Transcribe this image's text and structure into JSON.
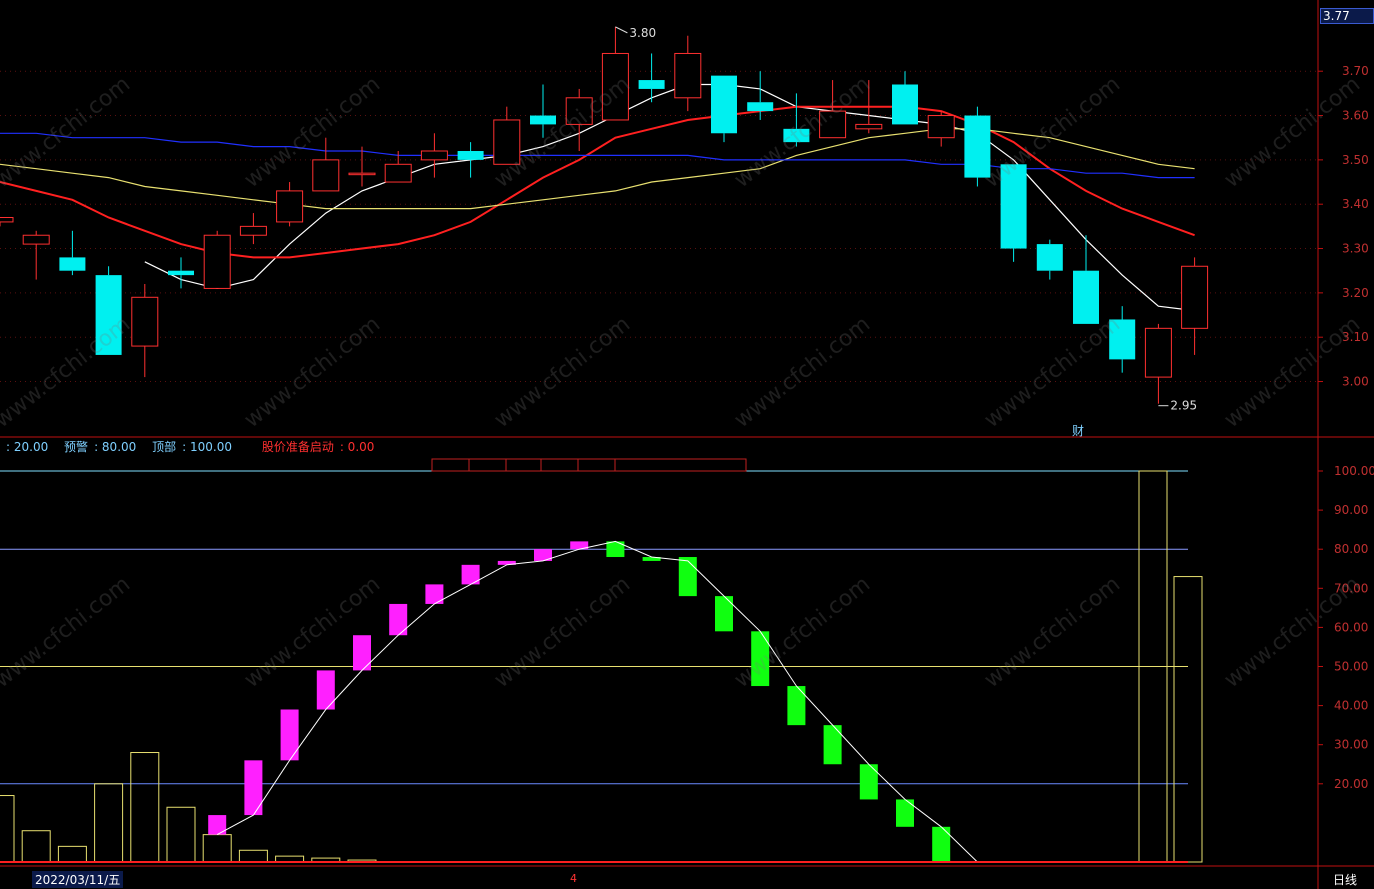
{
  "chart_data": [
    {
      "type": "candlestick",
      "title": "",
      "ylim": [
        2.92,
        3.82
      ],
      "y_ticks": [
        "3.70",
        "3.60",
        "3.50",
        "3.40",
        "3.30",
        "3.20",
        "3.10",
        "3.00"
      ],
      "high_label": "3.80",
      "low_label": "2.95",
      "current_price": "3.77",
      "candles": [
        {
          "o": 3.36,
          "c": 3.37,
          "h": 3.37,
          "l": 3.35
        },
        {
          "o": 3.31,
          "c": 3.33,
          "h": 3.34,
          "l": 3.23
        },
        {
          "o": 3.28,
          "c": 3.25,
          "h": 3.34,
          "l": 3.24
        },
        {
          "o": 3.24,
          "c": 3.06,
          "h": 3.26,
          "l": 3.06
        },
        {
          "o": 3.08,
          "c": 3.19,
          "h": 3.22,
          "l": 3.01
        },
        {
          "o": 3.25,
          "c": 3.24,
          "h": 3.28,
          "l": 3.21
        },
        {
          "o": 3.21,
          "c": 3.33,
          "h": 3.34,
          "l": 3.21
        },
        {
          "o": 3.33,
          "c": 3.35,
          "h": 3.38,
          "l": 3.31
        },
        {
          "o": 3.36,
          "c": 3.43,
          "h": 3.45,
          "l": 3.35
        },
        {
          "o": 3.43,
          "c": 3.5,
          "h": 3.55,
          "l": 3.43
        },
        {
          "o": 3.47,
          "c": 3.47,
          "h": 3.53,
          "l": 3.44
        },
        {
          "o": 3.45,
          "c": 3.49,
          "h": 3.52,
          "l": 3.45
        },
        {
          "o": 3.5,
          "c": 3.52,
          "h": 3.56,
          "l": 3.46
        },
        {
          "o": 3.52,
          "c": 3.5,
          "h": 3.54,
          "l": 3.46
        },
        {
          "o": 3.49,
          "c": 3.59,
          "h": 3.62,
          "l": 3.49
        },
        {
          "o": 3.6,
          "c": 3.58,
          "h": 3.67,
          "l": 3.55
        },
        {
          "o": 3.58,
          "c": 3.64,
          "h": 3.66,
          "l": 3.52
        },
        {
          "o": 3.59,
          "c": 3.74,
          "h": 3.8,
          "l": 3.59
        },
        {
          "o": 3.68,
          "c": 3.66,
          "h": 3.74,
          "l": 3.63
        },
        {
          "o": 3.64,
          "c": 3.74,
          "h": 3.78,
          "l": 3.61
        },
        {
          "o": 3.69,
          "c": 3.56,
          "h": 3.69,
          "l": 3.54
        },
        {
          "o": 3.63,
          "c": 3.61,
          "h": 3.7,
          "l": 3.59
        },
        {
          "o": 3.57,
          "c": 3.54,
          "h": 3.65,
          "l": 3.53
        },
        {
          "o": 3.55,
          "c": 3.61,
          "h": 3.68,
          "l": 3.55
        },
        {
          "o": 3.57,
          "c": 3.58,
          "h": 3.68,
          "l": 3.56
        },
        {
          "o": 3.67,
          "c": 3.58,
          "h": 3.7,
          "l": 3.58
        },
        {
          "o": 3.55,
          "c": 3.6,
          "h": 3.61,
          "l": 3.53
        },
        {
          "o": 3.6,
          "c": 3.46,
          "h": 3.62,
          "l": 3.44
        },
        {
          "o": 3.49,
          "c": 3.3,
          "h": 3.49,
          "l": 3.27
        },
        {
          "o": 3.31,
          "c": 3.25,
          "h": 3.32,
          "l": 3.23
        },
        {
          "o": 3.25,
          "c": 3.13,
          "h": 3.33,
          "l": 3.13
        },
        {
          "o": 3.14,
          "c": 3.05,
          "h": 3.17,
          "l": 3.02
        },
        {
          "o": 3.01,
          "c": 3.12,
          "h": 3.13,
          "l": 2.95
        },
        {
          "o": 3.12,
          "c": 3.26,
          "h": 3.28,
          "l": 3.06
        }
      ],
      "ma_lines": [
        {
          "color": "#ffffff",
          "values": [
            null,
            null,
            null,
            null,
            3.27,
            3.23,
            3.21,
            3.23,
            3.31,
            3.38,
            3.43,
            3.46,
            3.49,
            3.5,
            3.51,
            3.53,
            3.56,
            3.6,
            3.64,
            3.67,
            3.67,
            3.66,
            3.62,
            3.61,
            3.6,
            3.59,
            3.58,
            3.56,
            3.5,
            3.41,
            3.32,
            3.24,
            3.17,
            3.16
          ]
        },
        {
          "color": "#ff2020",
          "values": [
            3.45,
            3.43,
            3.41,
            3.37,
            3.34,
            3.31,
            3.29,
            3.28,
            3.28,
            3.29,
            3.3,
            3.31,
            3.33,
            3.36,
            3.41,
            3.46,
            3.5,
            3.55,
            3.57,
            3.59,
            3.6,
            3.61,
            3.62,
            3.62,
            3.62,
            3.62,
            3.61,
            3.58,
            3.54,
            3.48,
            3.43,
            3.39,
            3.36,
            3.33
          ]
        },
        {
          "color": "#e8e070",
          "values": [
            3.49,
            3.48,
            3.47,
            3.46,
            3.44,
            3.43,
            3.42,
            3.41,
            3.4,
            3.39,
            3.39,
            3.39,
            3.39,
            3.39,
            3.4,
            3.41,
            3.42,
            3.43,
            3.45,
            3.46,
            3.47,
            3.48,
            3.51,
            3.53,
            3.55,
            3.56,
            3.57,
            3.57,
            3.56,
            3.55,
            3.53,
            3.51,
            3.49,
            3.48
          ]
        },
        {
          "color": "#2030ff",
          "values": [
            3.56,
            3.56,
            3.55,
            3.55,
            3.55,
            3.54,
            3.54,
            3.53,
            3.53,
            3.52,
            3.52,
            3.51,
            3.51,
            3.51,
            3.51,
            3.51,
            3.51,
            3.51,
            3.51,
            3.51,
            3.5,
            3.5,
            3.5,
            3.5,
            3.5,
            3.5,
            3.49,
            3.49,
            3.48,
            3.48,
            3.47,
            3.47,
            3.46,
            3.46
          ]
        }
      ]
    },
    {
      "type": "oscillator",
      "ylim": [
        0,
        100
      ],
      "y_ticks": [
        "100.00",
        "90.00",
        "80.00",
        "70.00",
        "60.00",
        "50.00",
        "40.00",
        "30.00",
        "20.00"
      ],
      "legend": [
        {
          "label": "",
          "value": ": 20.00",
          "color": "#7fd0ff"
        },
        {
          "label": "预警",
          "value": ": 80.00",
          "color": "#7fd0ff"
        },
        {
          "label": "顶部",
          "value": ": 100.00",
          "color": "#7fd0ff"
        },
        {
          "label": "股价准备启动",
          "value": ": 0.00",
          "color": "#ff3030"
        }
      ],
      "boxes": [
        {
          "from": null,
          "to": null,
          "dir": "none"
        },
        {
          "from": null,
          "to": null,
          "dir": "none"
        },
        {
          "from": null,
          "to": null,
          "dir": "none"
        },
        {
          "from": null,
          "to": null,
          "dir": "none"
        },
        {
          "from": null,
          "to": null,
          "dir": "none"
        },
        {
          "from": null,
          "to": null,
          "dir": "none"
        },
        {
          "from": 7,
          "to": 12,
          "dir": "up"
        },
        {
          "from": 12,
          "to": 26,
          "dir": "up"
        },
        {
          "from": 26,
          "to": 39,
          "dir": "up"
        },
        {
          "from": 39,
          "to": 49,
          "dir": "up"
        },
        {
          "from": 49,
          "to": 58,
          "dir": "up"
        },
        {
          "from": 58,
          "to": 66,
          "dir": "up"
        },
        {
          "from": 66,
          "to": 71,
          "dir": "up"
        },
        {
          "from": 71,
          "to": 76,
          "dir": "up"
        },
        {
          "from": 76,
          "to": 77,
          "dir": "up"
        },
        {
          "from": 77,
          "to": 80,
          "dir": "up"
        },
        {
          "from": 80,
          "to": 82,
          "dir": "up"
        },
        {
          "from": 82,
          "to": 78,
          "dir": "down"
        },
        {
          "from": 78,
          "to": 77,
          "dir": "down"
        },
        {
          "from": 78,
          "to": 68,
          "dir": "down"
        },
        {
          "from": 68,
          "to": 59,
          "dir": "down"
        },
        {
          "from": 59,
          "to": 45,
          "dir": "down"
        },
        {
          "from": 45,
          "to": 35,
          "dir": "down"
        },
        {
          "from": 35,
          "to": 25,
          "dir": "down"
        },
        {
          "from": 25,
          "to": 16,
          "dir": "down"
        },
        {
          "from": 16,
          "to": 9,
          "dir": "down"
        },
        {
          "from": 9,
          "to": 0,
          "dir": "down"
        }
      ],
      "oscillator_line": [
        null,
        null,
        null,
        null,
        null,
        null,
        7,
        12,
        26,
        39,
        49,
        58,
        66,
        71,
        76,
        77,
        80,
        82,
        78,
        77,
        68,
        59,
        45,
        35,
        25,
        16,
        9,
        0
      ],
      "volume_bars": [
        17,
        8,
        4,
        20,
        28,
        14,
        7,
        3,
        1.5,
        1,
        0.5,
        0,
        0,
        0,
        0,
        0,
        0,
        0,
        0,
        0,
        0,
        0,
        0,
        0,
        0,
        0,
        0,
        0,
        0,
        0,
        0,
        100,
        73
      ],
      "reference_lines": [
        20,
        50,
        80,
        100
      ]
    }
  ],
  "footer": {
    "date": "2022/03/11/五",
    "period": "日线",
    "marker": "4"
  },
  "annotations": {
    "finance_mark": "财"
  },
  "watermark": "www.cfchi.com"
}
